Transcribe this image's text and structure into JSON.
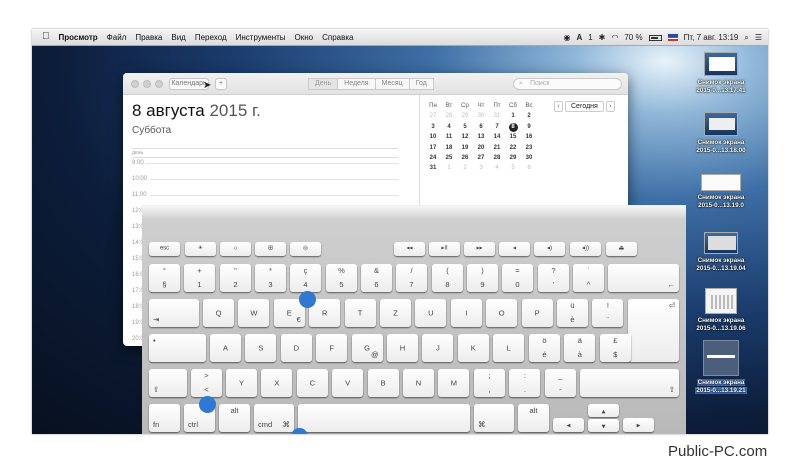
{
  "menubar": {
    "app": "Просмотр",
    "items": [
      "Файл",
      "Правка",
      "Вид",
      "Переход",
      "Инструменты",
      "Окно",
      "Справка"
    ],
    "status": {
      "ime": "1",
      "battery": "70 %",
      "clock": "Пт, 7 авг. 13:19"
    }
  },
  "calendar": {
    "calendars_button": "Календарь",
    "add_button": "+",
    "views": [
      "День",
      "Неделя",
      "Месяц",
      "Год"
    ],
    "search_placeholder": "Поиск",
    "date_day": "8 августа",
    "date_year": "2015 г.",
    "weekday": "Суббота",
    "allday_label": "день",
    "hours": [
      "9:00",
      "10:00",
      "11:00",
      "12:00",
      "13:00",
      "14:00",
      "15:00",
      "16:00",
      "17:00",
      "18:00",
      "19:00",
      "20:00"
    ],
    "today_button": "Сегодня",
    "mini_month": {
      "headers": [
        "Пн",
        "Вт",
        "Ср",
        "Чт",
        "Пт",
        "Сб",
        "Вс"
      ],
      "weeks": [
        [
          "27",
          "28",
          "29",
          "30",
          "31",
          "1",
          "2"
        ],
        [
          "3",
          "4",
          "5",
          "6",
          "7",
          "8",
          "9"
        ],
        [
          "10",
          "11",
          "12",
          "13",
          "14",
          "15",
          "16"
        ],
        [
          "17",
          "18",
          "19",
          "20",
          "21",
          "22",
          "23"
        ],
        [
          "24",
          "25",
          "26",
          "27",
          "28",
          "29",
          "30"
        ],
        [
          "31",
          "1",
          "2",
          "3",
          "4",
          "5",
          "6"
        ]
      ],
      "selected": "8"
    }
  },
  "keyboard": {
    "row_fn": [
      "esc",
      "☀",
      "☼",
      "⊞",
      "◎",
      "",
      "◂◂",
      "▸II",
      "▸▸",
      "◂",
      "◂)",
      "◂))",
      "⏏"
    ],
    "row_num": [
      {
        "t": "°",
        "b": "§"
      },
      {
        "t": "+",
        "b": "1"
      },
      {
        "t": "\"",
        "b": "2"
      },
      {
        "t": "*",
        "b": "3"
      },
      {
        "t": "ç",
        "b": "4"
      },
      {
        "t": "%",
        "b": "5"
      },
      {
        "t": "&",
        "b": "6"
      },
      {
        "t": "/",
        "b": "7"
      },
      {
        "t": "(",
        "b": "8"
      },
      {
        "t": ")",
        "b": "9"
      },
      {
        "t": "=",
        "b": "0"
      },
      {
        "t": "?",
        "b": "'"
      },
      {
        "t": "`",
        "b": "^"
      }
    ],
    "row_q": [
      "Q",
      "W",
      "E",
      "R",
      "T",
      "Z",
      "U",
      "I",
      "O",
      "P"
    ],
    "row_q_extra": [
      {
        "t": "ü",
        "b": "è"
      },
      {
        "t": "!",
        "b": "¨"
      }
    ],
    "euro": "€",
    "row_a": [
      "A",
      "S",
      "D",
      "F",
      "G",
      "H",
      "J",
      "K",
      "L"
    ],
    "row_a_extra": [
      {
        "t": "ö",
        "b": "é"
      },
      {
        "t": "ä",
        "b": "à"
      },
      {
        "t": "£",
        "b": "$"
      }
    ],
    "at": "@",
    "row_y": [
      "Y",
      "X",
      "C",
      "V",
      "B",
      "N",
      "M"
    ],
    "row_y_extra": [
      {
        "t": ";",
        "b": ","
      },
      {
        "t": ":",
        "b": "."
      },
      {
        "t": "_",
        "b": "-"
      }
    ],
    "lt": {
      "t": ">",
      "b": "<"
    },
    "labels": {
      "fn": "fn",
      "ctrl": "ctrl",
      "alt": "alt",
      "cmd": "cmd",
      "cmd_symbol": "⌘",
      "opt_symbol": "⌥"
    },
    "arrows": {
      "left": "◂",
      "up": "▴",
      "down": "▾",
      "right": "▸"
    },
    "return_glyph": "⏎",
    "back_glyph": "←",
    "tab_glyph": "⇥",
    "shift_glyph": "⇧",
    "caps_glyph": "•"
  },
  "desktop": {
    "icons": [
      {
        "label1": "Снимок экрана",
        "label2": "2015-0...13.17.41",
        "selected": false
      },
      {
        "label1": "Снимок экрана",
        "label2": "2015-0...13.18.00",
        "selected": false
      },
      {
        "label1": "Снимок экрана",
        "label2": "2015-0...13.19.0",
        "selected": false
      },
      {
        "label1": "Снимок экрана",
        "label2": "2015-0...13.19.04",
        "selected": false
      },
      {
        "label1": "Снимок экрана",
        "label2": "2015-0...13.19.06",
        "selected": false
      },
      {
        "label1": "Снимок экрана",
        "label2": "2015-0...13.19.21",
        "selected": true
      }
    ]
  },
  "watermark": "Public-PC.com",
  "colors": {
    "highlight": "#2f78d4",
    "selection": "#3b6db6"
  }
}
